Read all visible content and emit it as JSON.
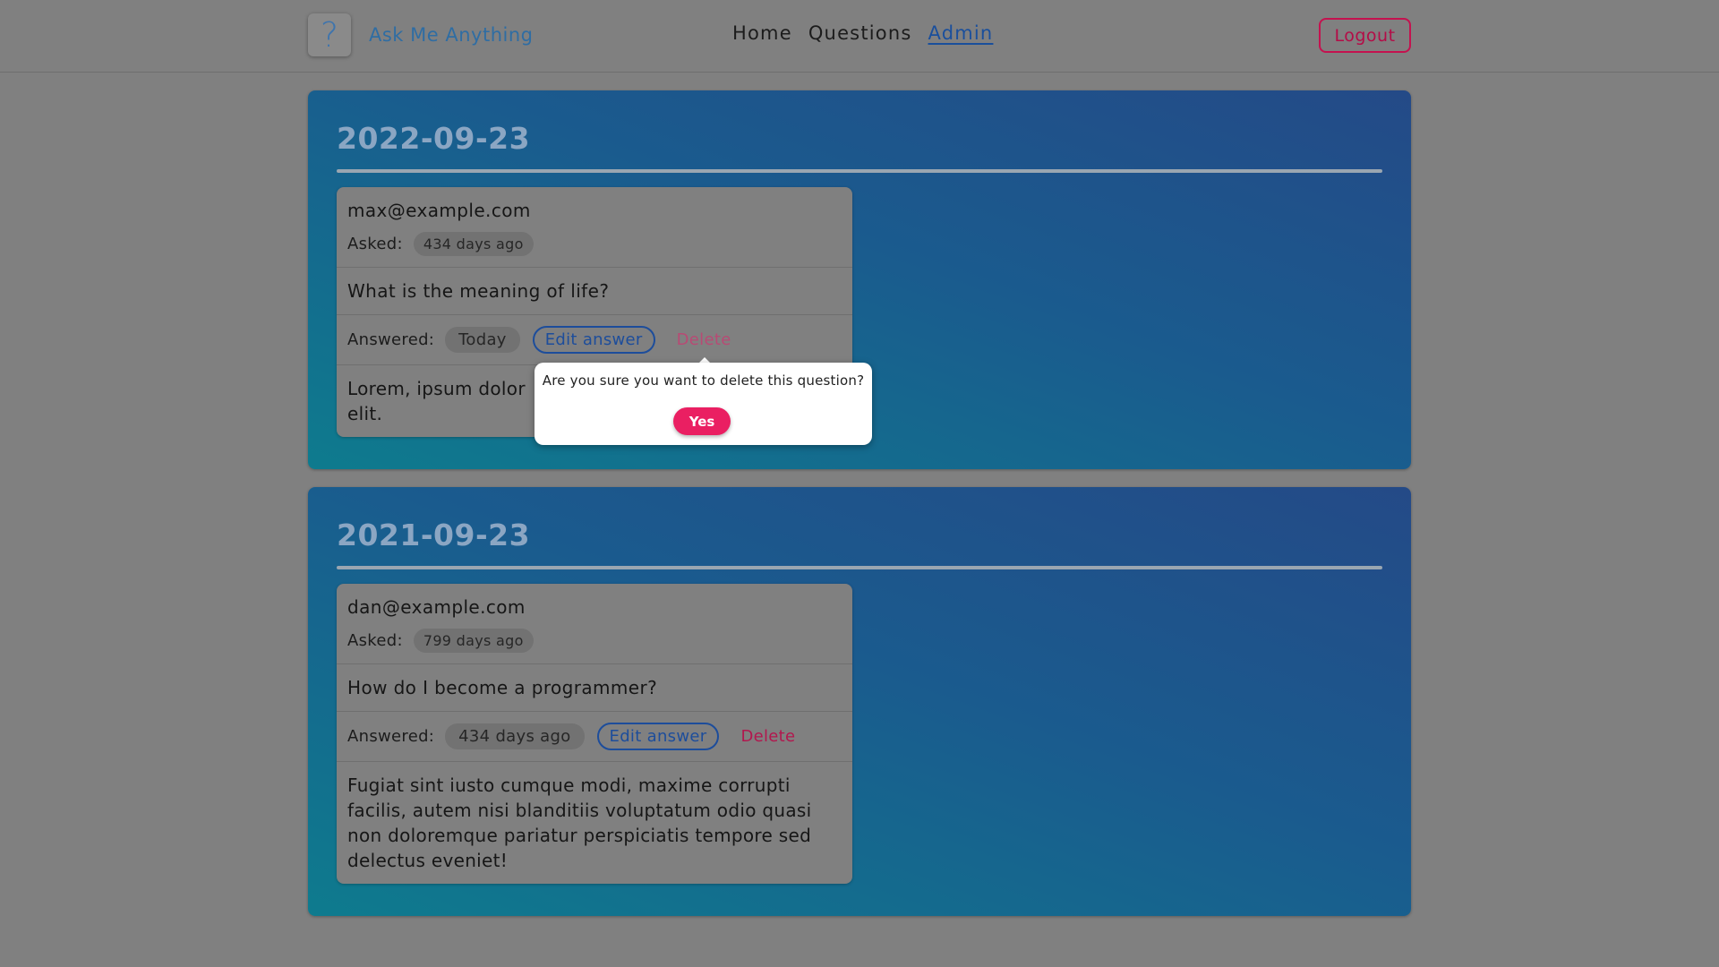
{
  "header": {
    "logo_glyph": "?",
    "app_name": "Ask Me Anything",
    "nav": [
      {
        "label": "Home"
      },
      {
        "label": "Questions"
      },
      {
        "label": "Admin"
      }
    ],
    "logout_label": "Logout"
  },
  "groups": [
    {
      "date": "2022-09-23",
      "question": {
        "email": "max@example.com",
        "asked_label": "Asked:",
        "asked_ago": "434 days ago",
        "text": "What is the meaning of life?",
        "answered_label": "Answered:",
        "answered_ago": "Today",
        "edit_label": "Edit answer",
        "delete_label": "Delete",
        "answer_visible": "Lorem, ipsum dolor",
        "answer_visible_line2": "elit."
      }
    },
    {
      "date": "2021-09-23",
      "question": {
        "email": "dan@example.com",
        "asked_label": "Asked:",
        "asked_ago": "799 days ago",
        "text": "How do I become a programmer?",
        "answered_label": "Answered:",
        "answered_ago": "434 days ago",
        "edit_label": "Edit answer",
        "delete_label": "Delete",
        "answer": "Fugiat sint iusto cumque modi, maxime corrupti facilis, autem nisi blanditiis voluptatum odio quasi non doloremque pariatur perspiciatis tempore sed delectus eveniet!"
      }
    }
  ],
  "confirm_popover": {
    "message": "Are you sure you want to delete this question?",
    "yes_label": "Yes"
  },
  "colors": {
    "page_bg": "#808080",
    "accent_blue": "#1d4d9b",
    "danger": "#c4124f",
    "yes_button": "#ea1f62"
  }
}
